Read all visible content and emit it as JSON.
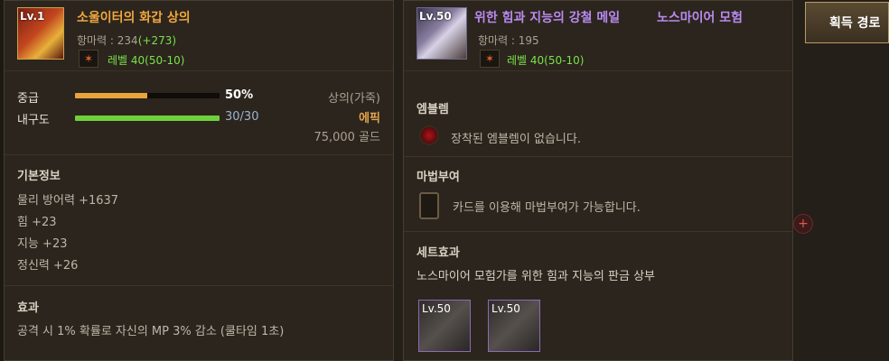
{
  "left_tooltip": {
    "item_icon": {
      "level": "Lv.1",
      "icon": "armor-icon"
    },
    "item_name": "소울이터의 화갑 상의",
    "resist": {
      "label": "항마력 : 234",
      "bonus": "(+273)"
    },
    "level_req": "레벨 40(50-10)",
    "grade": {
      "label": "중급",
      "percent": "50%",
      "value": 0.5
    },
    "durability": {
      "label": "내구도",
      "text": "30/30",
      "value": 1.0
    },
    "item_type": "상의(가죽)",
    "rarity": "에픽",
    "price": "75,000 골드",
    "basic_info": {
      "heading": "기본정보",
      "stats": [
        "물리 방어력 +1637",
        "힘 +23",
        "지능 +23",
        "정신력 +26"
      ]
    },
    "effect": {
      "heading": "효과",
      "text": "공격 시 1% 확률로 자신의 MP 3% 감소 (쿨타임 1초)"
    }
  },
  "right_tooltip": {
    "item_icon": {
      "level": "Lv.50",
      "icon": "armor-icon"
    },
    "item_name": "위한 힘과 지능의 강철 메일",
    "item_name_extra": "노스마이어 모험",
    "resist": {
      "label": "항마력 : 195"
    },
    "level_req": "레벨 40(50-10)",
    "emblem": {
      "heading": "엠블렘",
      "text": "장착된 엠블렘이 없습니다."
    },
    "enchant": {
      "heading": "마법부여",
      "text": "카드를 이용해 마법부여가 가능합니다."
    },
    "set_effect": {
      "heading": "세트효과",
      "name": "노스마이어 모험가를 위한 힘과 지능의 판금 상부",
      "items": [
        {
          "level": "Lv.50",
          "icon": "gauntlet-icon"
        },
        {
          "level": "Lv.50",
          "icon": "shoulder-armor-icon"
        }
      ]
    }
  },
  "acquire_button": "획득 경로",
  "colors": {
    "orange_title": "#f0a640",
    "purple_title": "#b98af0",
    "green": "#7be04a",
    "gold": "#e2a54a",
    "grade_bar": "#e8a33a",
    "durability_bar": "#6ed13c"
  }
}
